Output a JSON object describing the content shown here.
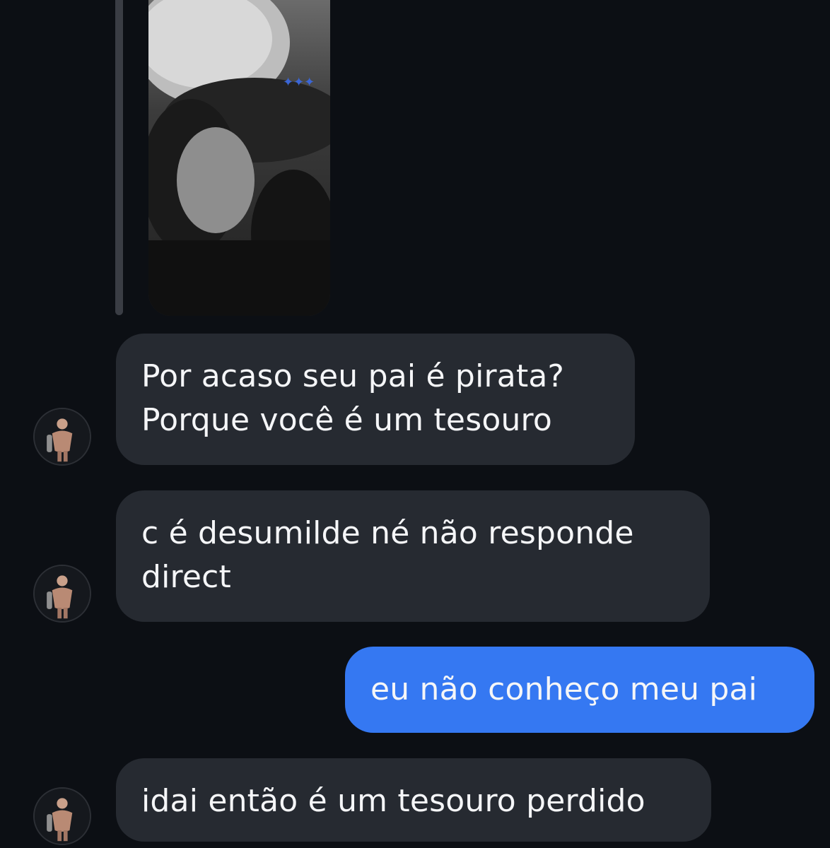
{
  "thread": {
    "messages": [
      {
        "sender": "other",
        "lines": [
          "Por acaso seu pai é pirata?",
          "Porque você é um tesouro"
        ]
      },
      {
        "sender": "other",
        "lines": [
          "c é desumilde né não responde",
          "direct"
        ]
      },
      {
        "sender": "me",
        "lines": [
          "eu não conheço meu pai"
        ]
      },
      {
        "sender": "other",
        "lines": [
          "idai então é um tesouro perdido"
        ]
      }
    ]
  },
  "colors": {
    "background": "#0c0f14",
    "incoming_bubble": "#262a31",
    "outgoing_bubble": "#3578f2",
    "text": "#f5f6f8"
  }
}
